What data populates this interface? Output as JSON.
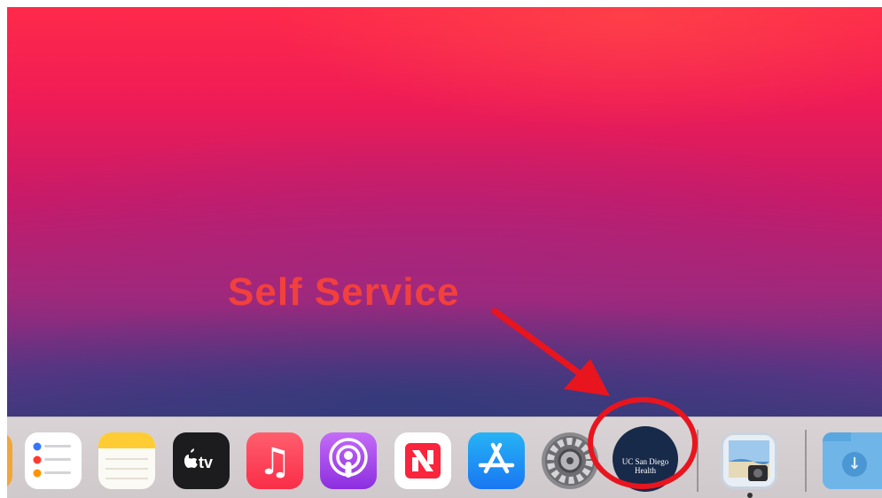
{
  "annotation": {
    "label": "Self Service"
  },
  "dock": {
    "items": [
      {
        "name": "Reminders",
        "icon": "reminders-icon"
      },
      {
        "name": "Notes",
        "icon": "notes-icon"
      },
      {
        "name": "TV",
        "icon": "apple-tv-icon",
        "text": "tv"
      },
      {
        "name": "Music",
        "icon": "music-icon",
        "glyph": "♫"
      },
      {
        "name": "Podcasts",
        "icon": "podcasts-icon"
      },
      {
        "name": "News",
        "icon": "news-icon"
      },
      {
        "name": "App Store",
        "icon": "app-store-icon"
      },
      {
        "name": "System Preferences",
        "icon": "gear-icon"
      },
      {
        "name": "Self Service",
        "icon": "self-service-icon",
        "text": "UC San Diego Health"
      },
      {
        "name": "Preview",
        "icon": "preview-icon"
      },
      {
        "name": "Downloads",
        "icon": "downloads-folder-icon",
        "glyph": "↓"
      }
    ]
  },
  "colors": {
    "annotation": "#e8151e",
    "label": "#f2403d"
  }
}
